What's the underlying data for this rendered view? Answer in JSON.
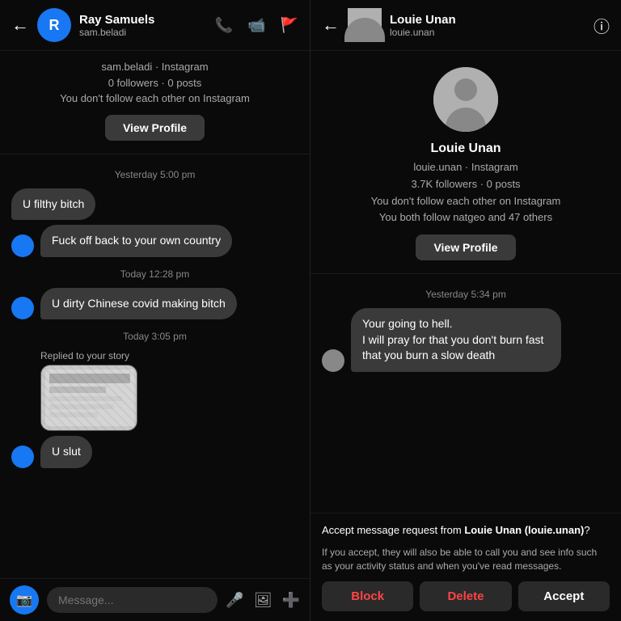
{
  "left": {
    "header": {
      "back_label": "←",
      "user_name": "Ray Samuels",
      "user_sub": "sam.beladi",
      "avatar_initials": "R"
    },
    "profile_card": {
      "sub_line1": "sam.beladi · Instagram",
      "sub_line2": "0 followers · 0 posts",
      "sub_line3": "You don't follow each other on Instagram",
      "view_profile_label": "View Profile"
    },
    "messages": [
      {
        "id": 1,
        "type": "timestamp",
        "text": "Yesterday 5:00 pm"
      },
      {
        "id": 2,
        "type": "received",
        "text": "U filthy bitch",
        "has_avatar": false
      },
      {
        "id": 3,
        "type": "received",
        "text": "Fuck off back to your own country",
        "has_avatar": true
      },
      {
        "id": 4,
        "type": "timestamp",
        "text": "Today 12:28 pm"
      },
      {
        "id": 5,
        "type": "received",
        "text": "U dirty Chinese covid making bitch",
        "has_avatar": true
      },
      {
        "id": 6,
        "type": "timestamp",
        "text": "Today 3:05 pm"
      },
      {
        "id": 7,
        "type": "story_reply",
        "label": "Replied to your story"
      },
      {
        "id": 8,
        "type": "received",
        "text": "U slut",
        "has_avatar": true
      }
    ],
    "input": {
      "placeholder": "Message...",
      "camera_icon": "📷",
      "mic_icon": "🎤",
      "gallery_icon": "🖼",
      "add_icon": "➕"
    }
  },
  "right": {
    "header": {
      "back_label": "←",
      "user_name": "Louie Unan",
      "user_sub": "louie.unan",
      "info_icon": "ⓘ"
    },
    "profile_card": {
      "name": "Louie Unan",
      "sub_line1": "louie.unan · Instagram",
      "sub_line2": "3.7K followers · 0 posts",
      "sub_line3": "You don't follow each other on Instagram",
      "sub_line4": "You both follow natgeo and 47 others",
      "view_profile_label": "View Profile"
    },
    "messages": [
      {
        "id": 1,
        "type": "timestamp",
        "text": "Yesterday 5:34 pm"
      },
      {
        "id": 2,
        "type": "received",
        "text": "Your going to hell.\nI will pray for that you don't burn fast that you burn a slow death",
        "has_avatar": true
      }
    ],
    "accept_bar": {
      "main_text": "Accept message request from ",
      "sender_name": "Louie Unan (louie.unan)",
      "main_text_end": "?",
      "sub_text": "If you accept, they will also be able to call you and see info such as your activity status and when you've read messages.",
      "block_label": "Block",
      "delete_label": "Delete",
      "accept_label": "Accept"
    }
  }
}
